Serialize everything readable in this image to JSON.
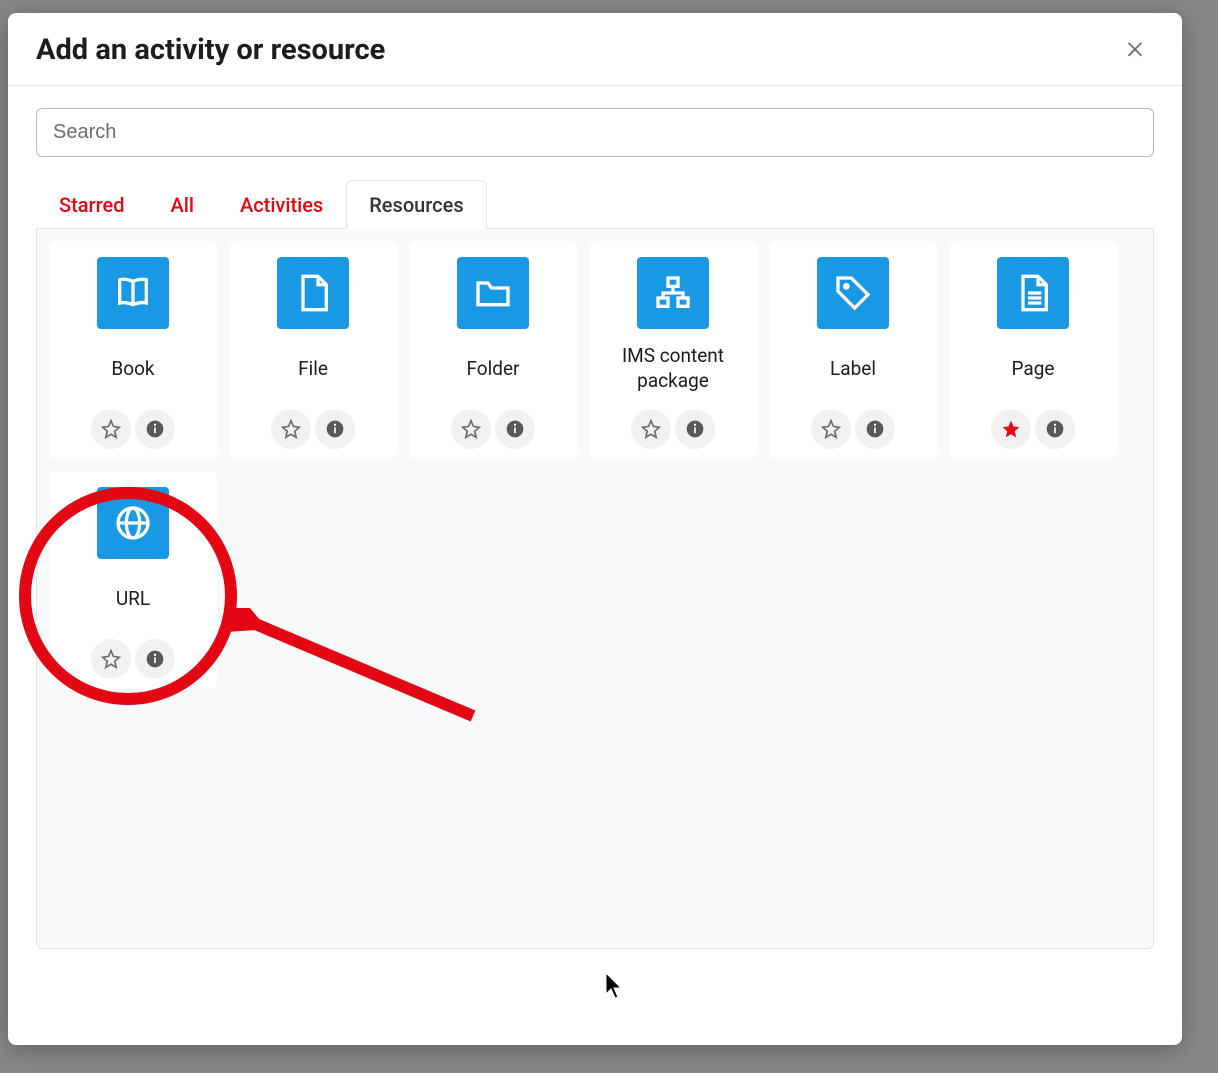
{
  "header": {
    "title": "Add an activity or resource"
  },
  "search": {
    "placeholder": "Search"
  },
  "tabs": [
    {
      "label": "Starred",
      "active": false
    },
    {
      "label": "All",
      "active": false
    },
    {
      "label": "Activities",
      "active": false
    },
    {
      "label": "Resources",
      "active": true
    }
  ],
  "resources": [
    {
      "name": "Book",
      "icon": "book",
      "starred": false
    },
    {
      "name": "File",
      "icon": "file",
      "starred": false
    },
    {
      "name": "Folder",
      "icon": "folder",
      "starred": false
    },
    {
      "name": "IMS content package",
      "icon": "ims",
      "starred": false
    },
    {
      "name": "Label",
      "icon": "label",
      "starred": false
    },
    {
      "name": "Page",
      "icon": "page",
      "starred": true
    },
    {
      "name": "URL",
      "icon": "url",
      "starred": false
    }
  ]
}
